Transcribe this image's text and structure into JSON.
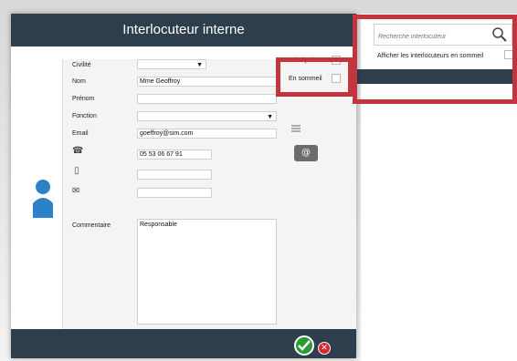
{
  "dialog": {
    "title": "Interlocuteur interne",
    "fields": {
      "civilite_label": "Civilité",
      "nom_label": "Nom",
      "nom_value": "Mme Geoffroy",
      "prenom_label": "Prénom",
      "fonction_label": "Fonction",
      "email_label": "Email",
      "email_value": "goeffroy@sim.com",
      "phone_value": "05 53 06 67 91",
      "commentaire_label": "Commentaire",
      "commentaire_value": "Responsable",
      "principal_label": "Principal",
      "en_sommeil_label": "En sommeil"
    },
    "icons": {
      "phone": "phone-icon",
      "mobile": "mobile-icon",
      "fax": "fax-icon",
      "email": "email-icon",
      "list": "list-icon",
      "avatar": "avatar-icon"
    },
    "footer": {
      "ok": "✔",
      "cancel": "✕"
    }
  },
  "side_panel": {
    "search_placeholder": "Recherche interlocuteur",
    "sleep_toggle_label": "Afficher les interlocuteurs en sommeil"
  },
  "colors": {
    "titlebar": "#2f3e4d",
    "accent_red": "#c4343d",
    "ok_green": "#2a9a32",
    "cancel_red": "#d7262c",
    "avatar_blue": "#2c82c9"
  }
}
